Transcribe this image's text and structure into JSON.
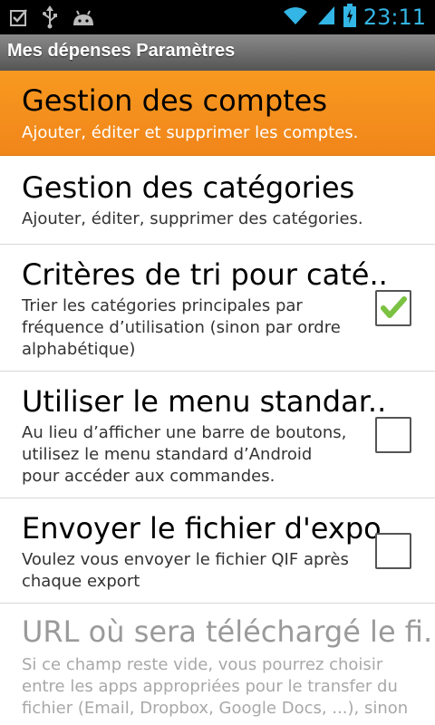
{
  "statusbar": {
    "time": "23:11",
    "left_icons": [
      "checkbox-notification-icon",
      "usb-icon",
      "android-icon"
    ],
    "right_icons": [
      "wifi-icon",
      "signal-icon",
      "battery-icon"
    ]
  },
  "titlebar": {
    "title": "Mes dépenses Paramètres"
  },
  "preferences": [
    {
      "title": "Gestion des comptes",
      "summary": "Ajouter, éditer et supprimer les comptes.",
      "selected": true
    },
    {
      "title": "Gestion des catégories",
      "summary": "Ajouter, éditer, supprimer des catégories."
    },
    {
      "title": "Critères de tri pour caté..",
      "summary_lines": [
        "Trier les catégories principales par",
        "fréquence d’utilisation (sinon par ordre",
        "alphabétique)"
      ],
      "checked": true
    },
    {
      "title": "Utiliser le menu standar..",
      "summary_lines": [
        "Au lieu d’afficher une barre de boutons,",
        "utilisez le menu standard d’Android",
        "pour accéder aux commandes."
      ],
      "checked": false
    },
    {
      "title": "Envoyer le fichier d'expo..",
      "summary_lines": [
        "Voulez vous envoyer le fichier QIF après",
        "chaque export"
      ],
      "checked": false
    },
    {
      "title": "URL où sera téléchargé le fi..",
      "summary_lines": [
        "Si ce champ reste vide, vous pourrez choisir",
        "entre les apps appropriées pour le transfer du",
        "fichier (Email, Dropbox, Google Docs, ...), sinon"
      ],
      "disabled": true
    }
  ],
  "colors": {
    "selected_start": "#f79a20",
    "selected_end": "#f1851a",
    "check_green": "#7bc242",
    "status_blue": "#33b5e5"
  }
}
